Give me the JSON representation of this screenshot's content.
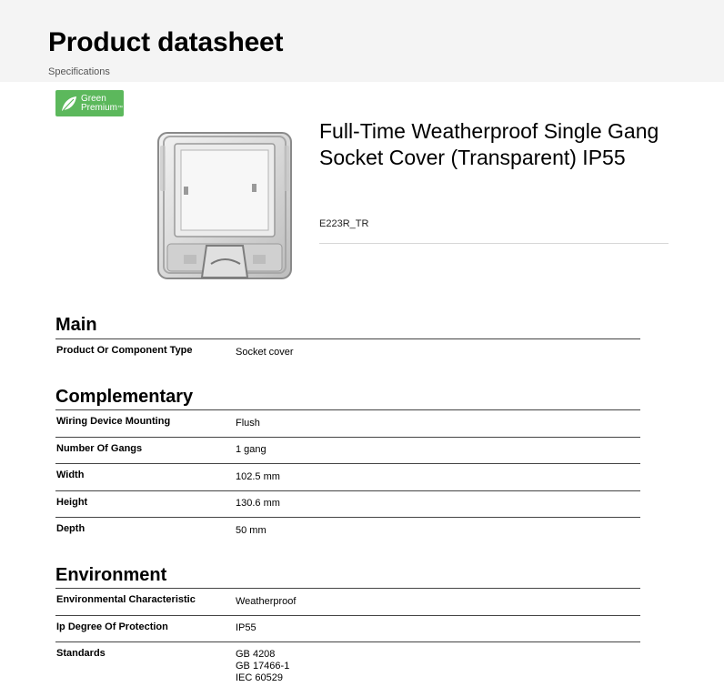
{
  "header": {
    "title": "Product datasheet",
    "subtitle": "Specifications"
  },
  "badge": {
    "line1": "Green",
    "line2": "Premium",
    "trademark": "™",
    "color": "#5cb85c",
    "icon": "leaf-icon"
  },
  "product": {
    "name": "Full-Time Weatherproof Single Gang Socket Cover (Transparent) IP55",
    "reference": "E223R_TR",
    "image": "transparent-socket-cover-image"
  },
  "sections": {
    "main": {
      "title": "Main",
      "rows": [
        {
          "label": "Product Or Component Type",
          "value": "Socket cover"
        }
      ]
    },
    "complementary": {
      "title": "Complementary",
      "rows": [
        {
          "label": "Wiring Device Mounting",
          "value": "Flush"
        },
        {
          "label": "Number Of Gangs",
          "value": "1 gang"
        },
        {
          "label": "Width",
          "value": "102.5 mm"
        },
        {
          "label": "Height",
          "value": "130.6 mm"
        },
        {
          "label": "Depth",
          "value": "50 mm"
        }
      ]
    },
    "environment": {
      "title": "Environment",
      "rows": [
        {
          "label": "Environmental Characteristic",
          "value": "Weatherproof"
        },
        {
          "label": "Ip Degree Of Protection",
          "value": "IP55"
        },
        {
          "label": "Standards",
          "values": [
            "GB 4208",
            "GB 17466-1",
            "IEC 60529"
          ]
        }
      ]
    }
  }
}
